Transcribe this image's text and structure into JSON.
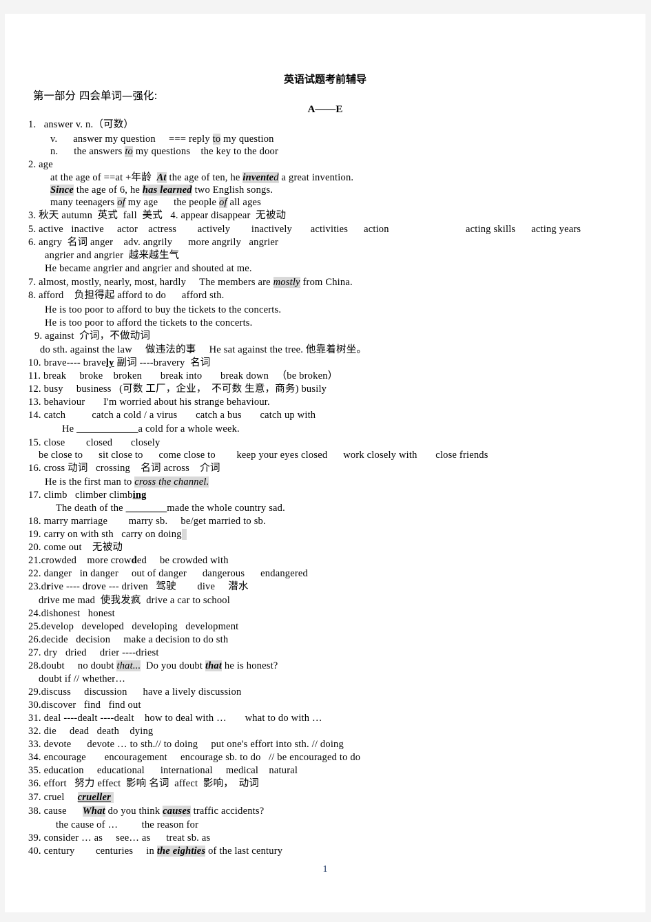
{
  "document": {
    "title": "英语试题考前辅导",
    "part_label": "第一部分 四会单词—强化:",
    "range_label": "A——E",
    "page_number": "1"
  },
  "entries": [
    {
      "num": "1.",
      "head": "answer v. n.（可数）"
    },
    {
      "sub": "v.  answer my question  === reply ",
      "hl1": "to",
      "tail": " my question"
    },
    {
      "sub2": "n.  the answers ",
      "hl2": "to",
      "tail2": " my questions  the key to the door"
    },
    {
      "num": "2.",
      "head": "age"
    },
    {
      "l": "at the age of ==at +年龄 ",
      "hl": "At",
      "l2": " the age of ten, he ",
      "hl_b": "invente",
      "l3": "d",
      "l4": " a great invention."
    },
    {
      "hl_b2": "Since",
      "l5": " the age of 6, he ",
      "hl_b3": "has learned",
      "l6": " two English songs."
    },
    {
      "l7": "many teenagers ",
      "hl_i": "of",
      "l8": " my age   the people ",
      "hl_i2": "of",
      "l9": " all ages"
    },
    {
      "num": "3.",
      "head": "秋天 autumn  英式  fall  美式   4. appear disappear  无被动"
    },
    {
      "num": "5.",
      "head": "active   inactive      actor    actress        actively        inactively       activities      action"
    },
    {
      "right_tail": "acting skills      acting years"
    },
    {
      "num": "6.",
      "head": "angry  名词 anger    adv. angrily     more angrily   angrier"
    },
    {
      "l": "angrier and angrier  越来越生气"
    },
    {
      "l": "He became angrier and angrier and shouted at me."
    },
    {
      "num": "7.",
      "head": "almost, mostly, nearly, most, hardly  The members are ",
      "hl": "mostly",
      "tail": " from China."
    },
    {
      "num": "8.",
      "head": "afford   负担得起 afford to do   afford sth."
    },
    {
      "l": "He is too poor to afford to buy the tickets to the concerts."
    },
    {
      "l": "He is too poor to afford the tickets to the concerts."
    },
    {
      "num": "9.",
      "head": "against  介词，不做动词"
    },
    {
      "l": "do sth. against the law  做违法的事  He sat against the tree. 他靠着树坐。"
    },
    {
      "num": "10.",
      "head": "brave---- brave",
      "bu": "ly",
      "tail": " 副词 ----bravery  名词"
    },
    {
      "num": "11.",
      "head": "break     broke    broken  break into  break down  （be broken）"
    },
    {
      "num": "12.",
      "head": "busy     business   (可数 工厂，企业，  不可数 生意，商务) busily"
    },
    {
      "num": "13.",
      "head": "behaviour  I'm worried about his strange behaviour."
    },
    {
      "num": "14.",
      "head": "catch   catch a cold / a virus  catch a bus  catch up with"
    },
    {
      "l": "He ____________a cold for a whole week."
    },
    {
      "num": "15.",
      "head": "close  closed  closely"
    },
    {
      "l": "be close to  sit close to  come close to   keep your eyes closed  work closely with   close friends"
    },
    {
      "num": "16.",
      "head": "cross 动词  crossing   名词 across   介词"
    },
    {
      "l": "He is the first man to ",
      "hl_i": "cross the channel."
    },
    {
      "num": "17.",
      "head": "climb  climber climb",
      "bu": "ing"
    },
    {
      "l": "The death of the ________made the whole country sad."
    },
    {
      "num": "18.",
      "head": "marry marriage  marry sb.   be/get married to sb."
    },
    {
      "num": "19.",
      "head": "carry on with sth   carry on doing"
    },
    {
      "num": "20.",
      "head": "come out  无被动"
    },
    {
      "num": "21.",
      "head": "crowded  more crow",
      "b": "d",
      "tail": "ed  be crowded with"
    },
    {
      "num": "22.",
      "head": "danger   in danger  out of danger   dangerous   endangered"
    },
    {
      "num": "23.",
      "head": "d",
      "b": "r",
      "tail": "ive ---- drove --- driven  驾驶   dive  潜水"
    },
    {
      "l": "drive me mad  使我发疯  drive a car to school"
    },
    {
      "num": "24.",
      "head": "dishonest   honest"
    },
    {
      "num": "25.",
      "head": "develop   developed   developing   development"
    },
    {
      "num": "26.",
      "head": "decide   decision  make a decision to do sth"
    },
    {
      "num": "27.",
      "head": "dry   dried  drier ----driest"
    },
    {
      "num": "28.",
      "head": "doubt  no doubt ",
      "hl_i": "that...",
      "mid": "  Do you doubt ",
      "hl_b": "that",
      "tail": " he is honest?"
    },
    {
      "l": "doubt if // whether…"
    },
    {
      "num": "29.",
      "head": "discuss  discussion   have a lively discussion"
    },
    {
      "num": "30.",
      "head": "discover  find   find out"
    },
    {
      "num": "31.",
      "head": "deal ----dealt ----dealt  how to deal with …   what to do with …"
    },
    {
      "num": "32.",
      "head": "die  dead   death  dying"
    },
    {
      "num": "33.",
      "head": "devote  devote … to sth.// to doing  put one's effort into sth. // doing"
    },
    {
      "num": "34.",
      "head": "encourage   encouragement  encourage sb. to do  // be encouraged to do"
    },
    {
      "num": "35.",
      "head": "education  educational  international  medical   natural"
    },
    {
      "num": "36.",
      "head": "effort  努力 effect  影响 名词  affect  影响， 动词"
    },
    {
      "num": "37.",
      "head": "cruel  ",
      "hl_bu": "crueller"
    },
    {
      "num": "38.",
      "head": "cause   ",
      "hl_b": "What",
      "mid": " do you think ",
      "hl_b2": "causes",
      "tail": " traffic accidents?"
    },
    {
      "l": "the cause of …   the reason for"
    },
    {
      "num": "39.",
      "head": "consider … as  see… as   treat sb. as"
    },
    {
      "num": "40.",
      "head": "century   centuries  in ",
      "hl_bi": "the eighties",
      "tail": " of the last century"
    }
  ],
  "lines": {
    "l1_num": "1.",
    "l1_text": "answer v. n.（可数）",
    "l2_sub_v": "v.",
    "l2_a": "answer my question",
    "l2_b": "=== reply ",
    "l2_hl": "to",
    "l2_c": " my question",
    "l3_sub_n": "n.",
    "l3_a": "the answers ",
    "l3_hl": "to",
    "l3_b": " my questions",
    "l3_c": "the key to the door",
    "l4_num": "2.",
    "l4_text": "age",
    "l5_a": "at the age of ==at +年龄",
    "l5_hl": "At",
    "l5_b": " the age of ten, he ",
    "l5_hlb": "invente",
    "l5_hlb_tail": "d",
    "l5_c": " a great invention.",
    "l6_hlb": "Since",
    "l6_a": " the age of 6, he ",
    "l6_hlb2": "has learned",
    "l6_b": " two English songs.",
    "l7_a": "many teenagers ",
    "l7_hl": "of",
    "l7_b": " my age",
    "l7_c": "the people ",
    "l7_hl2": "of",
    "l7_d": " all ages",
    "l8_num": "3.",
    "l8_text": "秋天 autumn  英式  fall  美式   4. appear disappear  无被动",
    "l9_num": "5.",
    "l9_text": "active   inactive     actor    actress        actively        inactively       activities      action",
    "l9_right": "acting skills      acting years",
    "l10_num": "6.",
    "l10_text": "angry  名词 anger    adv. angrily      more angrily   angrier",
    "l11_text": "angrier and angrier  越来越生气",
    "l12_text": "He became angrier and angrier and shouted at me.",
    "l13_num": "7.",
    "l13_a": "almost, mostly, nearly, most, hardly",
    "l13_b": "The members are ",
    "l13_hl": "mostly",
    "l13_c": " from China.",
    "l14_num": "8.",
    "l14_text": "afford    负担得起 afford to do      afford sth.",
    "l15_text": "He is too poor to afford to buy the tickets to the concerts.",
    "l16_text": "He is too poor to afford the tickets to the concerts.",
    "l17_num": "9.",
    "l17_text": "against  介词，不做动词",
    "l18_text": "do sth. against the law     做违法的事     He sat against the tree. 他靠着树坐。",
    "l19_num": "10.",
    "l19_a": "brave---- brave",
    "l19_bu": "ly",
    "l19_b": " 副词 ----bravery  名词",
    "l20_num": "11.",
    "l20_text": "break     broke    broken       break into       break down   （be broken）",
    "l21_num": "12.",
    "l21_text": "busy     business   (可数 工厂，企业，  不可数 生意，商务) busily",
    "l22_num": "13.",
    "l22_text": "behaviour       I'm worried about his strange behaviour.",
    "l23_num": "14.",
    "l23_text": "catch          catch a cold / a virus       catch a bus       catch up with",
    "l24_a": "He ",
    "l24_blank": "____________",
    "l24_b": "a cold for a whole week.",
    "l25_num": "15.",
    "l25_text": "close        closed       closely",
    "l26_text": "be close to      sit close to      come close to        keep your eyes closed      work closely with       close friends",
    "l27_num": "16.",
    "l27_text": "cross 动词   crossing    名词 across    介词",
    "l28_a": "He is the first man to ",
    "l28_hl": "cross the channel.",
    "l29_num": "17.",
    "l29_a": "climb   climber climb",
    "l29_bu": "ing",
    "l30_a": "The death of the ",
    "l30_blank": "________",
    "l30_b": "made the whole country sad.",
    "l31_num": "18.",
    "l31_text": "marry marriage        marry sb.     be/get married to sb.",
    "l32_num": "19.",
    "l32_a": "carry on with sth   carry on doing",
    "l33_num": "20.",
    "l33_text": "come out    无被动",
    "l34_num": "21.",
    "l34_a": "crowded    more crow",
    "l34_b": "d",
    "l34_c": "ed     be crowded with",
    "l35_num": "22.",
    "l35_text": "danger   in danger     out of danger      dangerous      endangered",
    "l36_num": "23.",
    "l36_a": "d",
    "l36_b": "r",
    "l36_c": "ive ---- drove --- driven   驾驶        dive     潜水",
    "l37_text": "drive me mad  使我发疯  drive a car to school",
    "l38_num": "24.",
    "l38_text": "dishonest   honest",
    "l39_num": "25.",
    "l39_text": "develop   developed   developing   development",
    "l40_num": "26.",
    "l40_text": "decide   decision     make a decision to do sth",
    "l41_num": "27.",
    "l41_text": "dry   dried     drier ----driest",
    "l42_num": "28.",
    "l42_a": "doubt     no doubt ",
    "l42_hl": "that...",
    "l42_b": "  Do you doubt ",
    "l42_hlb": "that",
    "l42_c": " he is honest?",
    "l43_text": "doubt if // whether…",
    "l44_num": "29.",
    "l44_text": "discuss     discussion      have a lively discussion",
    "l45_num": "30.",
    "l45_text": "discover   find   find out",
    "l46_num": "31.",
    "l46_text": "deal ----dealt ----dealt    how to deal with …       what to do with …",
    "l47_num": "32.",
    "l47_text": "die     dead   death    dying",
    "l48_num": "33.",
    "l48_text": "devote      devote … to sth.// to doing     put one's effort into sth. // doing",
    "l49_num": "34.",
    "l49_text": "encourage       encouragement     encourage sb. to do   // be encouraged to do",
    "l50_num": "35.",
    "l50_text": "education     educational      international     medical    natural",
    "l51_num": "36.",
    "l51_text": "effort   努力 effect  影响 名词  affect  影响，  动词",
    "l52_num": "37.",
    "l52_a": "cruel",
    "l52_hl": "crueller",
    "l53_num": "38.",
    "l53_a": "cause",
    "l53_hlb": "What",
    "l53_b": " do you think ",
    "l53_hlb2": "causes",
    "l53_c": " traffic accidents?",
    "l54_text": "the cause of …         the reason for",
    "l55_num": "39.",
    "l55_text": "consider … as     see… as      treat sb. as",
    "l56_num": "40.",
    "l56_a": "century        centuries     in ",
    "l56_hlbi": "the eighties",
    "l56_b": " of the last century"
  }
}
